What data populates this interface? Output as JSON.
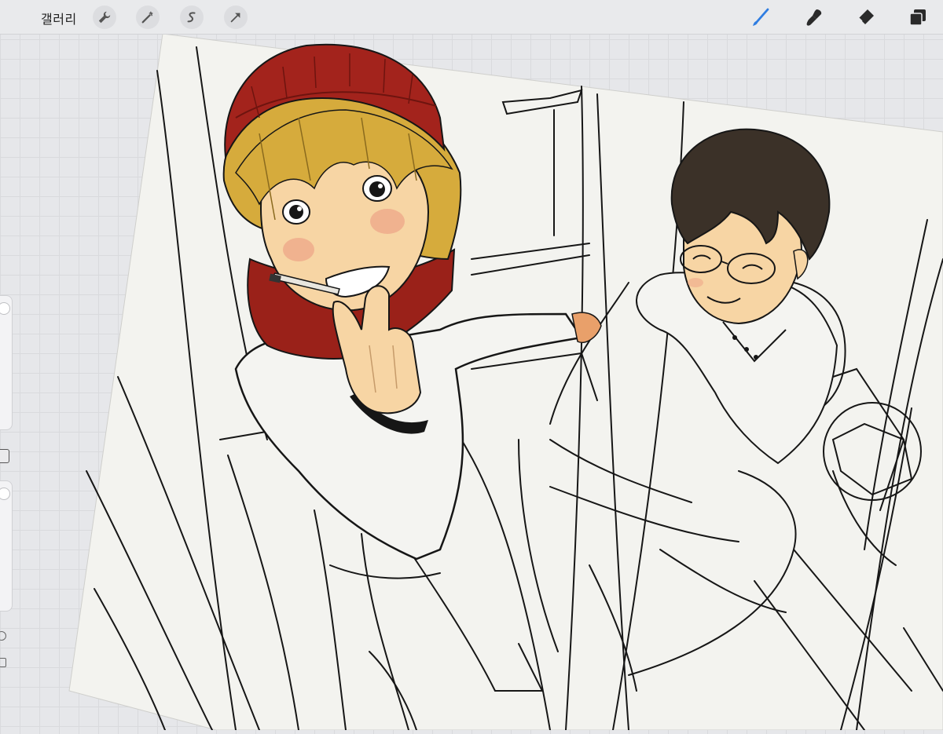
{
  "toolbar": {
    "gallery_label": "갤러리",
    "left_tools": [
      "wrench-icon",
      "magic-wand-icon",
      "selection-icon",
      "transform-arrow-icon"
    ],
    "right_tools": [
      "brush-icon",
      "smudge-icon",
      "eraser-icon",
      "layers-icon"
    ],
    "active_tool_color": "#2f7de1"
  },
  "sidebar": {
    "controls": [
      "brush-size-slider",
      "modify-button",
      "opacity-slider",
      "undo-button",
      "redo-button"
    ]
  },
  "artwork": {
    "paper_color": "#f3f3ef",
    "beanie_color": "#a3231c",
    "blond_hair_color": "#d8ae3e",
    "skin_color": "#f6d4a3",
    "dark_hair_color": "#3b3128"
  }
}
